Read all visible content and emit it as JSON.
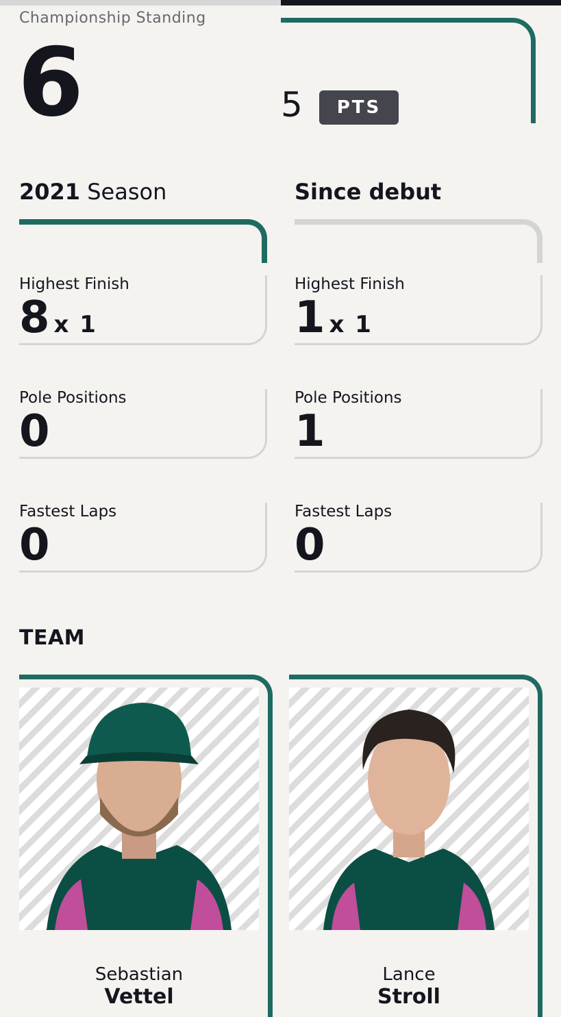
{
  "championship": {
    "label": "Championship Standing",
    "position": "6",
    "points": "5",
    "points_unit": "PTS"
  },
  "season": {
    "year": "2021",
    "label": "Season",
    "stats": [
      {
        "label": "Highest Finish",
        "value": "8",
        "multiplier": "x 1"
      },
      {
        "label": "Pole Positions",
        "value": "0",
        "multiplier": ""
      },
      {
        "label": "Fastest Laps",
        "value": "0",
        "multiplier": ""
      }
    ]
  },
  "career": {
    "title": "Since debut",
    "stats": [
      {
        "label": "Highest Finish",
        "value": "1",
        "multiplier": "x 1"
      },
      {
        "label": "Pole Positions",
        "value": "1",
        "multiplier": ""
      },
      {
        "label": "Fastest Laps",
        "value": "0",
        "multiplier": ""
      }
    ]
  },
  "team": {
    "title": "TEAM",
    "drivers": [
      {
        "first_name": "Sebastian",
        "last_name": "Vettel"
      },
      {
        "first_name": "Lance",
        "last_name": "Stroll"
      }
    ]
  },
  "colors": {
    "accent": "#1e6b62",
    "text": "#15151e",
    "badge": "#45454d",
    "background": "#f4f3f0"
  }
}
